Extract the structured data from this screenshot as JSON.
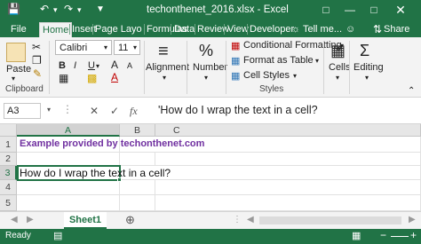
{
  "window": {
    "title": "techonthenet_2016.xlsx - Excel"
  },
  "quick_access": [
    "save-icon",
    "undo-icon",
    "redo-icon",
    "customize-icon"
  ],
  "ribbon_tabs": [
    "File",
    "Home",
    "Insert",
    "Page Layo",
    "Formulas",
    "Data",
    "Review",
    "View",
    "Developer"
  ],
  "tell_me": "Tell me...",
  "share": "Share",
  "ribbon": {
    "clipboard": {
      "paste_label": "Paste",
      "group_label": "Clipboard"
    },
    "font": {
      "font_name": "Calibri",
      "font_size": "11",
      "bold": "B",
      "italic": "I",
      "underline": "U",
      "grow": "A",
      "shrink": "A",
      "font_color": "A"
    },
    "alignment": {
      "label": "Alignment"
    },
    "number": {
      "label": "Number",
      "percent": "%"
    },
    "styles": {
      "conditional": "Conditional Formatting",
      "format_table": "Format as Table",
      "cell_styles": "Cell Styles",
      "group_label": "Styles"
    },
    "cells": {
      "label": "Cells"
    },
    "editing": {
      "label": "Editing"
    }
  },
  "formula_bar": {
    "name_box": "A3",
    "fx": "fx",
    "content": "'How do I wrap the text in a cell?"
  },
  "grid": {
    "columns": [
      "A",
      "B",
      "C"
    ],
    "rows": [
      "1",
      "2",
      "3",
      "4",
      "5"
    ],
    "cells": {
      "A1": "Example provided by techonthenet.com",
      "A3": "How do I wrap the text in a cell?"
    },
    "colors": {
      "a1_text": "#7030a0"
    }
  },
  "sheets": [
    "Sheet1"
  ],
  "status": {
    "mode": "Ready"
  },
  "accent": "#217346"
}
